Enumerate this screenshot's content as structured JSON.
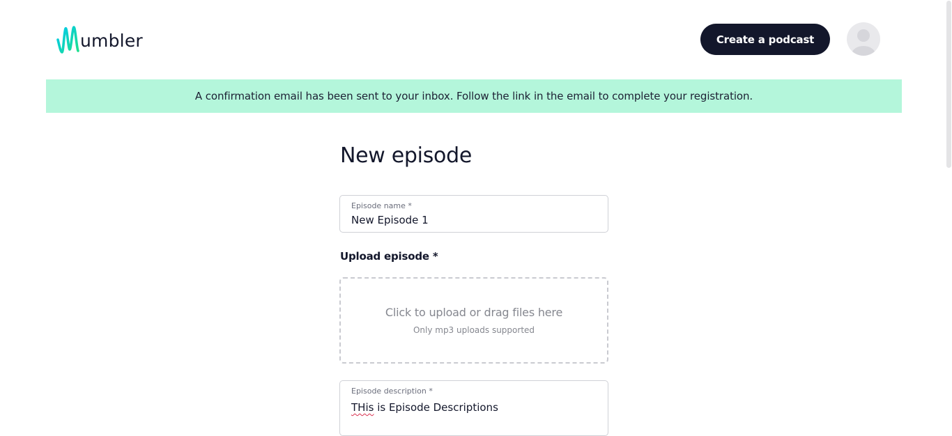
{
  "header": {
    "logo_text": "umbler",
    "create_label": "Create a podcast"
  },
  "banner": {
    "message": "A confirmation email has been sent to your inbox. Follow the link in the email to complete your registration."
  },
  "page": {
    "title": "New episode"
  },
  "form": {
    "episode_name": {
      "label": "Episode name *",
      "value": "New Episode 1"
    },
    "upload": {
      "label": "Upload episode *",
      "main_text": "Click to upload or drag files here",
      "sub_text": "Only mp3 uploads supported"
    },
    "description": {
      "label": "Episode description *",
      "misspelled_word": "THis",
      "rest_text": " is Episode Descriptions"
    }
  },
  "colors": {
    "brand_dark": "#13172b",
    "banner_bg": "#b4f6db",
    "logo_gradient_start": "#00c8f0",
    "logo_gradient_end": "#1ee08c"
  },
  "icons": {
    "logo": "wumbler-waveform-logo",
    "avatar": "user-avatar-placeholder-icon"
  }
}
